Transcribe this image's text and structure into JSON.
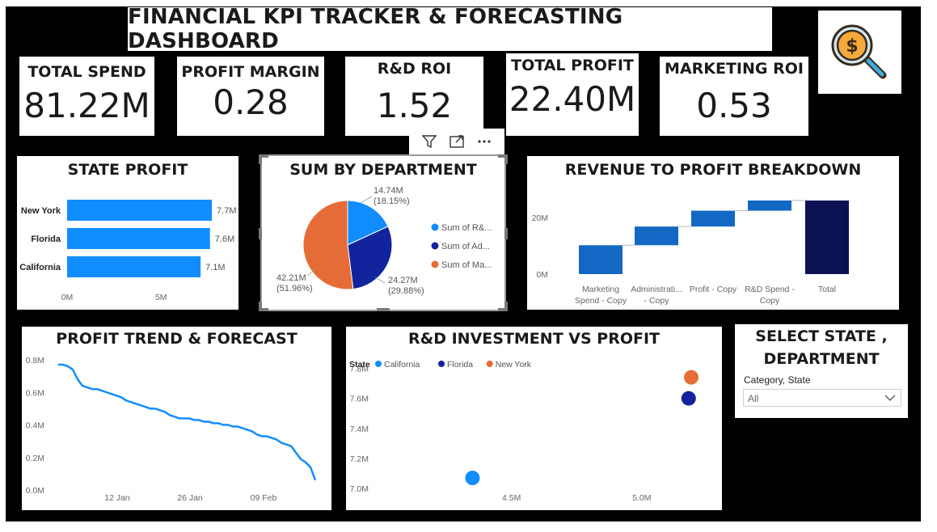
{
  "title": "FINANCIAL KPI TRACKER & FORECASTING DASHBOARD",
  "logo": {
    "icon": "dollar-magnifier-icon"
  },
  "kpis": [
    {
      "label": "TOTAL SPEND",
      "value": "81.22M"
    },
    {
      "label": "PROFIT MARGIN",
      "value": "0.28"
    },
    {
      "label": "R&D ROI",
      "value": "1.52"
    },
    {
      "label": "TOTAL PROFIT",
      "value": "22.40M"
    },
    {
      "label": "MARKETING ROI",
      "value": "0.53"
    }
  ],
  "visual_toolbar": {
    "icons": [
      "filter-icon",
      "focus-mode-icon",
      "more-options-icon"
    ]
  },
  "colors": {
    "light_blue": "#118DFF",
    "dark_blue": "#12239E",
    "orange": "#E66C37",
    "waterfall_blue": "#1368C4",
    "waterfall_total": "#0B1152"
  },
  "state_profit": {
    "title": "STATE PROFIT",
    "chart_data": {
      "type": "bar",
      "orientation": "horizontal",
      "categories": [
        "New York",
        "Florida",
        "California"
      ],
      "values": [
        7.7,
        7.6,
        7.1
      ],
      "data_labels": [
        "7.7M",
        "7.6M",
        "7.1M"
      ],
      "x_ticks": [
        "0M",
        "5M"
      ],
      "xlim": [
        0,
        8.3
      ]
    }
  },
  "sum_by_department": {
    "title": "SUM BY DEPARTMENT",
    "chart_data": {
      "type": "pie",
      "slices": [
        {
          "legend": "Sum of R&...",
          "value": 14.74,
          "label": "14.74M",
          "pct": "(18.15%)",
          "color": "#118DFF"
        },
        {
          "legend": "Sum of Ad...",
          "value": 24.27,
          "label": "24.27M",
          "pct": "(29.88%)",
          "color": "#12239E"
        },
        {
          "legend": "Sum of Ma...",
          "value": 42.21,
          "label": "42.21M",
          "pct": "(51.96%)",
          "color": "#E66C37"
        }
      ]
    }
  },
  "revenue_breakdown": {
    "title": "REVENUE TO PROFIT BREAKDOWN",
    "chart_data": {
      "type": "waterfall",
      "categories": [
        [
          "Marketing",
          "Spend - Copy"
        ],
        [
          "Administrati...",
          "- Copy"
        ],
        [
          "Profit - Copy"
        ],
        [
          "R&D Spend -",
          "Copy"
        ],
        [
          "Total"
        ]
      ],
      "steps": [
        {
          "start": 0,
          "end": 10.2
        },
        {
          "start": 10.2,
          "end": 16.8
        },
        {
          "start": 16.8,
          "end": 22.4
        },
        {
          "start": 22.4,
          "end": 26.0
        },
        {
          "start": 0,
          "end": 26.0,
          "total": true
        }
      ],
      "y_ticks": [
        "0M",
        "20M"
      ],
      "ylim": [
        0,
        28
      ]
    }
  },
  "profit_trend": {
    "title": "PROFIT TREND & FORECAST",
    "chart_data": {
      "type": "line",
      "x_ticks": [
        "12 Jan",
        "26 Jan",
        "09 Feb"
      ],
      "y_ticks": [
        "0.0M",
        "0.2M",
        "0.4M",
        "0.6M",
        "0.8M"
      ],
      "ylim": [
        0,
        0.8
      ],
      "values": [
        0.77,
        0.77,
        0.76,
        0.74,
        0.68,
        0.64,
        0.63,
        0.62,
        0.62,
        0.61,
        0.6,
        0.59,
        0.58,
        0.57,
        0.55,
        0.54,
        0.53,
        0.52,
        0.51,
        0.5,
        0.5,
        0.49,
        0.48,
        0.46,
        0.45,
        0.44,
        0.44,
        0.44,
        0.43,
        0.43,
        0.42,
        0.42,
        0.41,
        0.41,
        0.4,
        0.4,
        0.39,
        0.39,
        0.38,
        0.37,
        0.36,
        0.34,
        0.33,
        0.33,
        0.32,
        0.31,
        0.29,
        0.28,
        0.27,
        0.23,
        0.19,
        0.17,
        0.14,
        0.06
      ]
    }
  },
  "rd_vs_profit": {
    "title": "R&D INVESTMENT VS PROFIT",
    "legend_title": "State",
    "chart_data": {
      "type": "scatter",
      "series": [
        {
          "name": "California",
          "x": 4.35,
          "y": 7.07,
          "color": "#118DFF"
        },
        {
          "name": "Florida",
          "x": 5.18,
          "y": 7.6,
          "color": "#12239E"
        },
        {
          "name": "New York",
          "x": 5.19,
          "y": 7.74,
          "color": "#E66C37"
        }
      ],
      "x_ticks": [
        "4.5M",
        "5.0M"
      ],
      "y_ticks": [
        "7.0M",
        "7.2M",
        "7.4M",
        "7.6M",
        "7.8M"
      ],
      "xlim": [
        3.97,
        5.28
      ],
      "ylim": [
        6.99,
        7.83
      ]
    }
  },
  "slicer": {
    "title_line1": "SELECT STATE ,",
    "title_line2": "DEPARTMENT",
    "field": "Category, State",
    "value": "All"
  }
}
